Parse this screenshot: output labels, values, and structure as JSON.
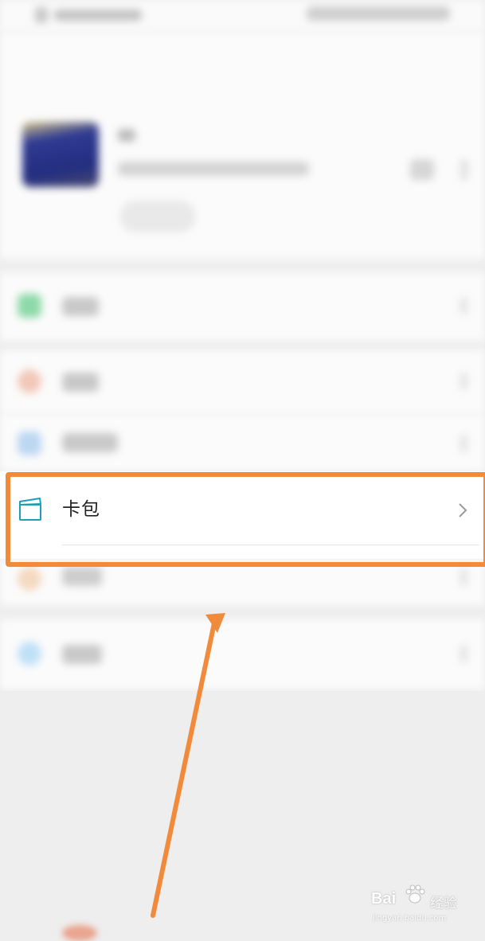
{
  "card_pack_row": {
    "label": "卡包",
    "icon": "card-wallet-icon",
    "chevron_icon": "chevron-right-icon"
  },
  "annotation": {
    "arrow_color": "#f28a3c",
    "highlight_color": "#f28a3c"
  },
  "watermark": {
    "brand": "Bai",
    "brand_suffix": "经验",
    "url": "jingyan.baidu.com"
  }
}
